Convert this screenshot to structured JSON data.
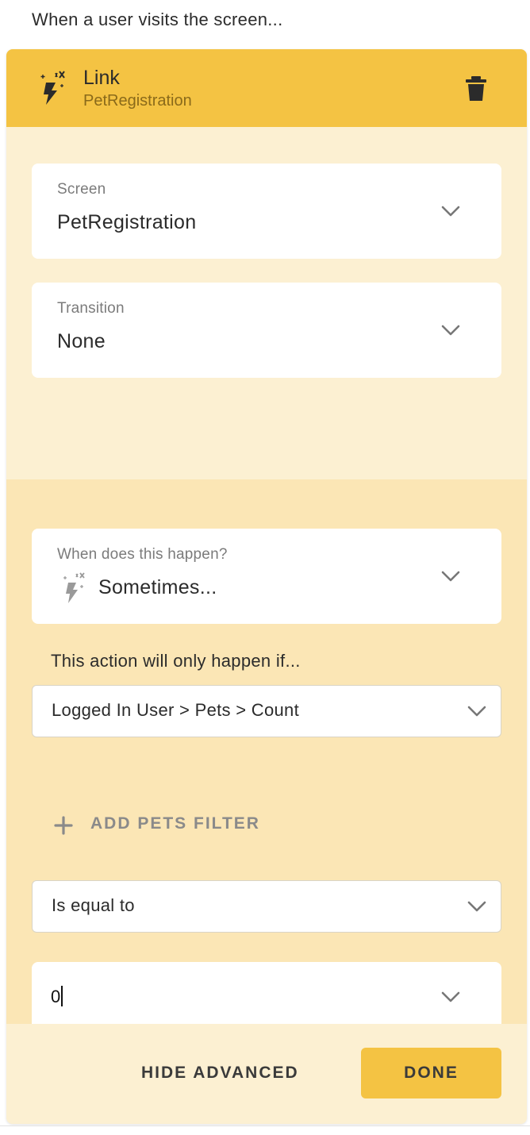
{
  "caption": "When a user visits the screen...",
  "action": {
    "icon": "magic-action-icon",
    "title": "Link",
    "subtitle": "PetRegistration",
    "delete_icon": "trash-icon"
  },
  "fields": {
    "screen": {
      "label": "Screen",
      "value": "PetRegistration"
    },
    "transition": {
      "label": "Transition",
      "value": "None"
    }
  },
  "advanced": {
    "when": {
      "label": "When does this happen?",
      "value": "Sometimes...",
      "icon": "magic-action-icon"
    },
    "condition_text": "This action will only happen if...",
    "source_select": "Logged In User > Pets > Count",
    "add_filter_label": "ADD PETS FILTER",
    "operator_select": "Is equal to",
    "compare_value": "0"
  },
  "footer": {
    "hide_advanced_label": "HIDE ADVANCED",
    "done_label": "DONE"
  },
  "colors": {
    "header": "#f4c343",
    "panel": "#fcf0d2",
    "advanced": "#fbe6b5",
    "done": "#f4c343"
  }
}
